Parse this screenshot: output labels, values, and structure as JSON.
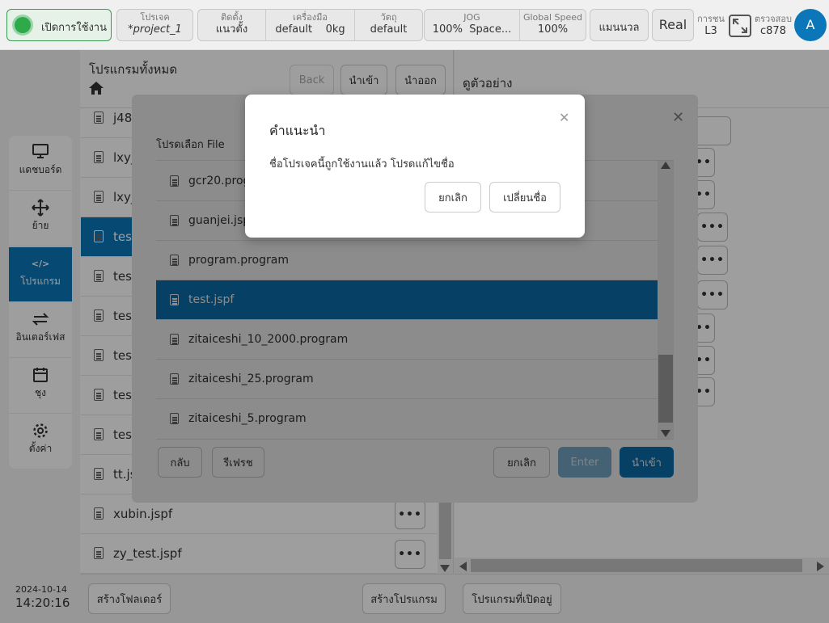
{
  "topbar": {
    "power_label": "เปิดการใช้งาน",
    "project_label": "โปรเจค",
    "project_value": "*project_1",
    "install_label": "ติดตั้ง",
    "install_value": "แนวตั้ง",
    "tool_label": "เครื่องมือ",
    "tool_value": "default",
    "tool_weight": "0kg",
    "object_label": "วัตถุ",
    "object_value": "default",
    "jog_label": "JOG",
    "jog_value": "100%",
    "jog_space": "Space...",
    "speed_label": "Global Speed",
    "speed_value": "100%",
    "manual_label": "แมนนวล",
    "real_label": "Real",
    "collision_label": "การชน",
    "collision_value": "L3",
    "check_label": "ตรวจสอบ",
    "check_value": "c878",
    "avatar_letter": "A"
  },
  "sidebar": {
    "items": [
      {
        "label": "แดชบอร์ด",
        "icon": "monitor-icon"
      },
      {
        "label": "ย้าย",
        "icon": "move-icon"
      },
      {
        "label": "โปรแกรม",
        "icon": "code-icon"
      },
      {
        "label": "อินเตอร์เฟส",
        "icon": "swap-icon"
      },
      {
        "label": "ชุง",
        "icon": "calendar-icon"
      },
      {
        "label": "ตั้งค่า",
        "icon": "gear-icon"
      }
    ],
    "date": "2024-10-14",
    "time": "14:20:16"
  },
  "program_panel": {
    "title": "โปรแกรมทั้งหมด",
    "back_label": "Back",
    "import_label": "นำเข้า",
    "export_label": "นำออก",
    "files": [
      "j48",
      "lxy_",
      "lxy_",
      "test",
      "test",
      "test",
      "test",
      "test",
      "test",
      "tt.js",
      "xubin.jspf",
      "zy_test.jspf"
    ],
    "create_folder_label": "สร้างโฟลเดอร์",
    "create_program_label": "สร้างโปรแกรม"
  },
  "preview_panel": {
    "title": "ดูตัวอย่าง",
    "open_programs_label": "โปรแกรมที่เปิดอยู่"
  },
  "file_modal": {
    "title": "โปรดเลือก File",
    "files": [
      "gcr20.progr",
      "guanjei.jspf",
      "program.program",
      "test.jspf",
      "zitaiceshi_10_2000.program",
      "zitaiceshi_25.program",
      "zitaiceshi_5.program"
    ],
    "selected_index": 3,
    "back_label": "กลับ",
    "refresh_label": "รีเฟรช",
    "cancel_label": "ยกเลิก",
    "enter_label": "Enter",
    "import_label": "นำเข้า"
  },
  "alert_dialog": {
    "title": "คำแนะนำ",
    "message": "ชื่อโปรเจคนี้ถูกใช้งานแล้ว โปรดแก้ไขชื่อ",
    "cancel_label": "ยกเลิก",
    "rename_label": "เปลี่ยนชื่อ"
  },
  "colors": {
    "accent": "#0b76b8",
    "power_green": "#2eaa4a"
  }
}
